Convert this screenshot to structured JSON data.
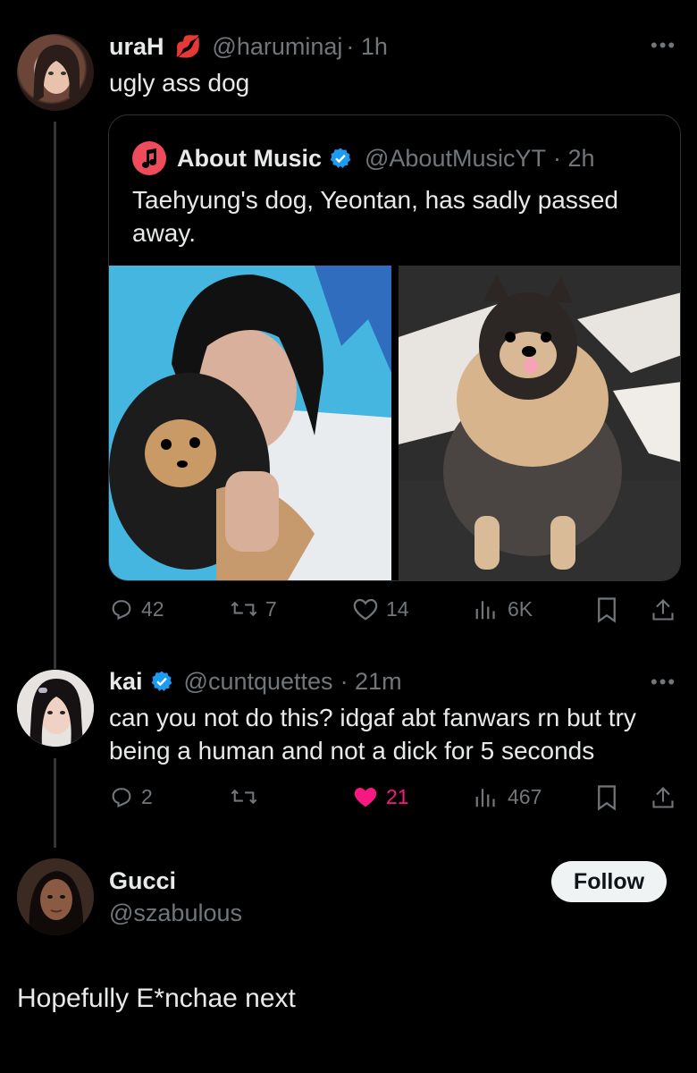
{
  "tweet1": {
    "name": "uraH",
    "name_emoji": "💋",
    "handle": "@haruminaj",
    "time": "· 1h",
    "text": "ugly ass dog",
    "more": "•••"
  },
  "quote": {
    "name": "About Music",
    "handle": "@AboutMusicYT",
    "time": "· 2h",
    "text": "Taehyung's dog, Yeontan, has sadly passed away."
  },
  "tweet1_actions": {
    "replies": "42",
    "reposts": "7",
    "likes": "14",
    "views": "6K"
  },
  "tweet2": {
    "name": "kai",
    "handle": "@cuntquettes",
    "time": "· 21m",
    "text": "can you not do this? idgaf abt fanwars rn but try being a human and not a dick for 5 seconds",
    "more": "•••"
  },
  "tweet2_actions": {
    "replies": "2",
    "reposts": "",
    "likes": "21",
    "views": "467"
  },
  "tweet3": {
    "name": "Gucci",
    "handle": "@szabulous",
    "follow_label": "Follow",
    "text": "Hopefully E*nchae next"
  },
  "colors": {
    "background": "#000000",
    "text": "#e7e9ea",
    "secondary": "#71767b",
    "verified": "#1d9bf0",
    "liked": "#f91880",
    "quote_border": "#2f3336"
  }
}
